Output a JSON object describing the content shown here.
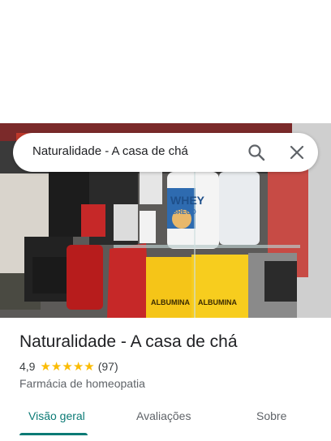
{
  "search": {
    "query": "Naturalidade - A casa de chá"
  },
  "place": {
    "name": "Naturalidade - A casa de chá",
    "rating": "4,9",
    "review_count": "(97)",
    "stars": 5,
    "category": "Farmácia de homeopatia"
  },
  "photo": {
    "products": [
      "WHEY",
      "GREGO",
      "ALBUMINA",
      "ALBUMINA"
    ]
  },
  "tabs": [
    {
      "label": "Visão geral",
      "active": true
    },
    {
      "label": "Avaliações",
      "active": false
    },
    {
      "label": "Sobre",
      "active": false
    }
  ],
  "colors": {
    "accent": "#0b7a75",
    "star": "#fbbc04"
  }
}
